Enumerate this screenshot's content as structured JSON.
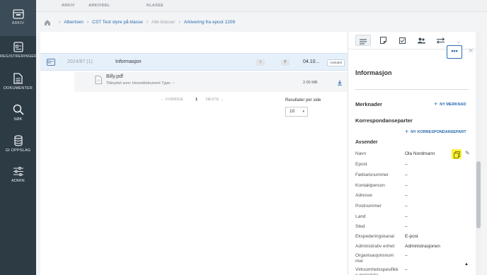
{
  "nav": {
    "items": [
      {
        "label": "ARKIV",
        "icon": "archive-icon"
      },
      {
        "label": "REGISTRERINGER",
        "icon": "registration-icon"
      },
      {
        "label": "DOKUMENTER",
        "icon": "document-icon"
      },
      {
        "label": "SØK",
        "icon": "search-icon"
      },
      {
        "label": "GI OPPSLAG",
        "icon": "database-icon"
      },
      {
        "label": "ADMIN",
        "icon": "sliders-icon"
      }
    ]
  },
  "column_headers": [
    "ARKIV",
    "ARKIVDEL",
    "KLASSE"
  ],
  "breadcrumb": {
    "items": [
      {
        "label": "Albertsen",
        "muted": false
      },
      {
        "label": "CST Test styre på klasse",
        "muted": false
      },
      {
        "label": "Alle klasser",
        "muted": true
      },
      {
        "label": "Arkivering fra epost 1209",
        "muted": false
      }
    ]
  },
  "list": {
    "row": {
      "number": "2024/87 (1)",
      "title": "Informasjon",
      "tag_i": "I",
      "tag_f": "F",
      "date": "04.10...",
      "status": "Avsluttet"
    },
    "file": {
      "name": "Billy.pdf",
      "meta": "Tilknyttet som:  Hoveddokument   Type:  --",
      "size": "2.00 MB"
    },
    "pager": {
      "prev": "← FORRIGE",
      "current": "1",
      "next": "NESTE →"
    },
    "results_per_page_label": "Resultater per side",
    "results_per_page_value": "10"
  },
  "detail": {
    "title": "Informasjon",
    "merknader_label": "Merknader",
    "ny_merknad": "NY MERKNAD",
    "korrespondanseparter_label": "Korrespondanseparter",
    "ny_korrespondansepart": "NY KORRESPONDANSEPART",
    "avsender_label": "Avsender",
    "fields": [
      {
        "key": "Navn",
        "value": "Ola Nordmann"
      },
      {
        "key": "Epost",
        "value": "–"
      },
      {
        "key": "Fødselsnummer",
        "value": "–"
      },
      {
        "key": "Kontaktperson",
        "value": "–"
      },
      {
        "key": "Adresse",
        "value": "–"
      },
      {
        "key": "Postnummer",
        "value": "–"
      },
      {
        "key": "Land",
        "value": "–"
      },
      {
        "key": "Sted",
        "value": "–"
      },
      {
        "key": "Ekspederingskanal",
        "value": "E-post"
      },
      {
        "key": "Administrativ enhet",
        "value": "Administrasjonen"
      },
      {
        "key": "Organisasjonsnummer",
        "value": "–"
      },
      {
        "key": "Virksomhetsspesifikke metadata",
        "value": "–"
      }
    ]
  },
  "colors": {
    "nav_bg": "#2d3b45",
    "accent": "#2b6cb0",
    "highlight": "#fff23a",
    "selected_row": "#e6f0fb"
  }
}
